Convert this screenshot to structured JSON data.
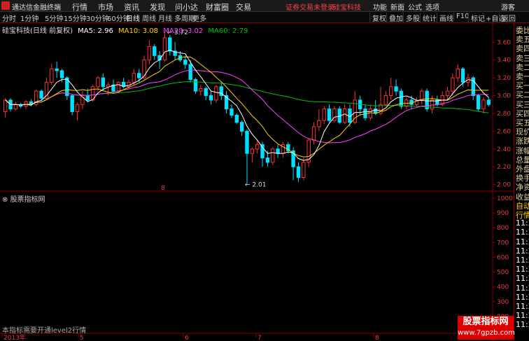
{
  "menubar": {
    "app_name": "通达信金融终端",
    "items": [
      "行情",
      "市场",
      "资讯",
      "发现",
      "问小达",
      "财富圈",
      "交易"
    ],
    "alert": "证券交易未登录",
    "stock_name": "硅宝科技",
    "right_items": [
      "功能",
      "新面",
      "公式",
      "选项"
    ],
    "user": "游客"
  },
  "toolbar": {
    "periods": [
      "分时",
      "1分钟",
      "5分钟",
      "15分钟",
      "30分钟",
      "60分钟",
      "日线",
      "周线",
      "月线",
      "多周期",
      "更多"
    ],
    "active": "日线",
    "right_items": [
      "复权",
      "叠加",
      "多股",
      "统计",
      "画线",
      "F10",
      "标记",
      "+自选",
      "返回"
    ]
  },
  "info": {
    "title": "硅宝科技(日线 前复权)",
    "ma5": "MA5: 2.96",
    "ma10": "MA10: 3.08",
    "ma20": "MA20: 3.02",
    "ma60": "MA60: 2.79"
  },
  "annotations": {
    "high": "3.72",
    "low": "2.01"
  },
  "y_axis": [
    "3.60",
    "3.40",
    "3.20",
    "3.00",
    "2.80",
    "2.60",
    "2.40",
    "2.20",
    "2.00"
  ],
  "sub_axis": [
    "1000",
    "900",
    "800",
    "700",
    "600",
    "500",
    "400",
    "300",
    "200",
    "100"
  ],
  "x_axis": [
    "2013年",
    "5",
    "6",
    "7",
    "8"
  ],
  "month_marker": "8",
  "sub_title": "股票指标网",
  "sub_note": "本指标需要开通level2行情",
  "right_panel": [
    "委比",
    "卖五",
    "卖四",
    "卖三",
    "卖二",
    "卖一",
    "买一",
    "买二",
    "买三",
    "买四",
    "买五",
    "现价",
    "涨跌",
    "涨幅",
    "总量",
    "外盘",
    "换手",
    "净资",
    "收益",
    "自动",
    "行情",
    "11:2",
    "11:2",
    "11:2",
    "11:2",
    "11:2",
    "11:2",
    "11:2",
    "11:2",
    "11:2",
    "11:2",
    "11:2",
    "11:2"
  ],
  "watermark": {
    "title": "股票指标网",
    "url": "www.7gpzb.com"
  },
  "colors": {
    "up": "#ff3030",
    "down": "#00e0ff",
    "ma5": "#ffffff",
    "ma10": "#ffd000",
    "ma20": "#ff40ff",
    "ma60": "#00c000",
    "frame": "#8b0000"
  },
  "chart_data": {
    "type": "candlestick",
    "ylim": [
      1.95,
      3.72
    ],
    "candles": [
      [
        2.82,
        2.95,
        2.75,
        2.97
      ],
      [
        2.95,
        2.85,
        2.82,
        2.97
      ],
      [
        2.85,
        2.9,
        2.83,
        2.93
      ],
      [
        2.9,
        2.88,
        2.86,
        2.92
      ],
      [
        2.88,
        2.93,
        2.85,
        2.95
      ],
      [
        2.93,
        2.9,
        2.88,
        2.96
      ],
      [
        2.9,
        3.05,
        2.88,
        3.07
      ],
      [
        3.05,
        2.97,
        2.95,
        3.07
      ],
      [
        2.97,
        3.15,
        2.95,
        3.2
      ],
      [
        3.15,
        3.3,
        3.12,
        3.36
      ],
      [
        3.3,
        3.28,
        3.2,
        3.38
      ],
      [
        3.28,
        3.2,
        3.15,
        3.3
      ],
      [
        3.2,
        3.0,
        2.95,
        3.22
      ],
      [
        3.0,
        2.82,
        2.78,
        3.02
      ],
      [
        2.82,
        2.9,
        2.72,
        2.92
      ],
      [
        2.9,
        3.0,
        2.85,
        3.05
      ],
      [
        3.0,
        2.95,
        2.92,
        3.08
      ],
      [
        2.95,
        3.1,
        2.93,
        3.12
      ],
      [
        3.1,
        3.2,
        3.05,
        3.22
      ],
      [
        3.2,
        3.1,
        3.05,
        3.25
      ],
      [
        3.1,
        3.12,
        3.0,
        3.15
      ],
      [
        3.12,
        3.05,
        3.03,
        3.18
      ],
      [
        3.05,
        3.15,
        3.03,
        3.16
      ],
      [
        3.15,
        3.1,
        3.08,
        3.2
      ],
      [
        3.1,
        3.15,
        3.08,
        3.18
      ],
      [
        3.15,
        3.25,
        3.12,
        3.3
      ],
      [
        3.25,
        3.2,
        3.15,
        3.3
      ],
      [
        3.2,
        3.4,
        3.18,
        3.45
      ],
      [
        3.4,
        3.55,
        3.35,
        3.62
      ],
      [
        3.55,
        3.45,
        3.4,
        3.58
      ],
      [
        3.45,
        3.4,
        3.3,
        3.5
      ],
      [
        3.4,
        3.65,
        3.38,
        3.72
      ],
      [
        3.65,
        3.5,
        3.45,
        3.68
      ],
      [
        3.5,
        3.45,
        3.4,
        3.6
      ],
      [
        3.45,
        3.4,
        3.38,
        3.5
      ],
      [
        3.4,
        3.35,
        3.3,
        3.45
      ],
      [
        3.35,
        3.18,
        3.15,
        3.4
      ],
      [
        3.18,
        3.05,
        3.02,
        3.2
      ],
      [
        3.05,
        3.08,
        3.0,
        3.12
      ],
      [
        3.08,
        3.0,
        2.95,
        3.1
      ],
      [
        3.0,
        2.95,
        2.9,
        3.05
      ],
      [
        2.95,
        3.1,
        2.92,
        3.12
      ],
      [
        3.1,
        3.0,
        2.95,
        3.15
      ],
      [
        3.0,
        2.85,
        2.8,
        3.05
      ],
      [
        2.85,
        2.78,
        2.75,
        2.9
      ],
      [
        2.78,
        2.7,
        2.68,
        2.8
      ],
      [
        2.7,
        2.6,
        2.55,
        2.72
      ],
      [
        2.6,
        2.35,
        2.01,
        2.62
      ],
      [
        2.35,
        2.4,
        2.25,
        2.42
      ],
      [
        2.4,
        2.45,
        2.35,
        2.5
      ],
      [
        2.45,
        2.3,
        2.2,
        2.48
      ],
      [
        2.3,
        2.25,
        2.2,
        2.38
      ],
      [
        2.25,
        2.4,
        2.22,
        2.42
      ],
      [
        2.4,
        2.35,
        2.3,
        2.45
      ],
      [
        2.35,
        2.45,
        2.3,
        2.48
      ],
      [
        2.45,
        2.38,
        2.35,
        2.48
      ],
      [
        2.38,
        2.2,
        2.05,
        2.42
      ],
      [
        2.2,
        2.08,
        2.03,
        2.25
      ],
      [
        2.08,
        2.25,
        2.05,
        2.3
      ],
      [
        2.25,
        2.5,
        2.2,
        2.52
      ],
      [
        2.5,
        2.65,
        2.45,
        2.7
      ],
      [
        2.65,
        2.72,
        2.6,
        2.85
      ],
      [
        2.72,
        2.85,
        2.68,
        2.88
      ],
      [
        2.85,
        2.72,
        2.7,
        2.9
      ],
      [
        2.72,
        2.85,
        2.7,
        2.88
      ],
      [
        2.85,
        2.7,
        2.68,
        2.88
      ],
      [
        2.7,
        2.85,
        2.68,
        2.9
      ],
      [
        2.85,
        2.7,
        2.65,
        2.9
      ],
      [
        2.7,
        2.95,
        2.68,
        3.05
      ],
      [
        2.95,
        2.85,
        2.78,
        3.0
      ],
      [
        2.85,
        2.75,
        2.72,
        2.9
      ],
      [
        2.75,
        2.85,
        2.72,
        2.9
      ],
      [
        2.85,
        2.8,
        2.78,
        2.95
      ],
      [
        2.8,
        2.9,
        2.78,
        3.1
      ],
      [
        2.9,
        3.0,
        2.88,
        3.05
      ],
      [
        3.0,
        3.1,
        2.95,
        3.2
      ],
      [
        3.1,
        3.05,
        3.0,
        3.18
      ],
      [
        3.05,
        2.88,
        2.85,
        3.08
      ],
      [
        2.88,
        2.95,
        2.85,
        2.98
      ],
      [
        2.95,
        2.9,
        2.85,
        3.0
      ],
      [
        2.9,
        2.95,
        2.88,
        2.98
      ],
      [
        2.95,
        3.05,
        2.9,
        3.08
      ],
      [
        3.05,
        2.85,
        2.82,
        3.08
      ],
      [
        2.85,
        2.95,
        2.8,
        3.0
      ],
      [
        2.95,
        2.9,
        2.88,
        3.0
      ],
      [
        2.9,
        3.0,
        2.88,
        3.05
      ],
      [
        3.0,
        3.05,
        2.95,
        3.1
      ],
      [
        3.05,
        3.2,
        3.0,
        3.25
      ],
      [
        3.2,
        3.3,
        3.15,
        3.35
      ],
      [
        3.3,
        3.15,
        3.1,
        3.32
      ],
      [
        3.15,
        3.2,
        3.1,
        3.25
      ],
      [
        3.2,
        3.0,
        2.95,
        3.22
      ],
      [
        3.0,
        2.85,
        2.82,
        3.02
      ],
      [
        2.85,
        2.95,
        2.8,
        2.98
      ],
      [
        2.95,
        2.9,
        2.88,
        2.98
      ]
    ]
  }
}
